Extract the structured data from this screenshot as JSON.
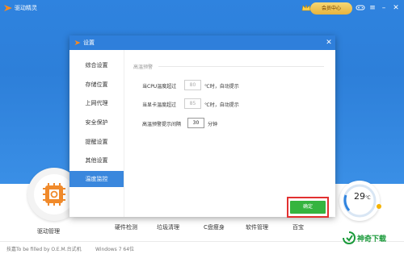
{
  "app": {
    "title": "驱动精灵",
    "vip_label": "会员中心"
  },
  "dialog": {
    "title": "设置",
    "sidebar": [
      {
        "label": "综合设置"
      },
      {
        "label": "存储位置"
      },
      {
        "label": "上网代理"
      },
      {
        "label": "安全保护"
      },
      {
        "label": "提醒设置"
      },
      {
        "label": "其他设置"
      },
      {
        "label": "温度监控",
        "active": true
      }
    ],
    "section_title": "高温预警",
    "cpu": {
      "label": "当CPU温度超过",
      "value": "80",
      "suffix": "℃时，自动提示"
    },
    "gpu": {
      "label": "当显卡温度超过",
      "value": "85",
      "suffix": "℃时，自动提示"
    },
    "interval": {
      "label": "高温预警提示间隔",
      "value": "30",
      "suffix": "分钟"
    },
    "ok_label": "确定"
  },
  "bottom_nav": {
    "driver_manage": "驱动管理",
    "items": [
      "硬件检测",
      "垃圾清理",
      "C盘瘦身",
      "软件管理",
      "百宝"
    ]
  },
  "temperature": {
    "value": "29",
    "unit": "℃"
  },
  "footer": {
    "left_text": "技嘉To be filled by O.E.M.台式机",
    "os_text": "Windows 7 64位"
  },
  "brand": {
    "text": "神奇下载"
  },
  "colors": {
    "header_blue": "#2f83df",
    "accent_blue": "#3a87dd",
    "ok_green": "#35b43f",
    "highlight_red": "#e23030",
    "brand_green": "#1a9a3a"
  }
}
